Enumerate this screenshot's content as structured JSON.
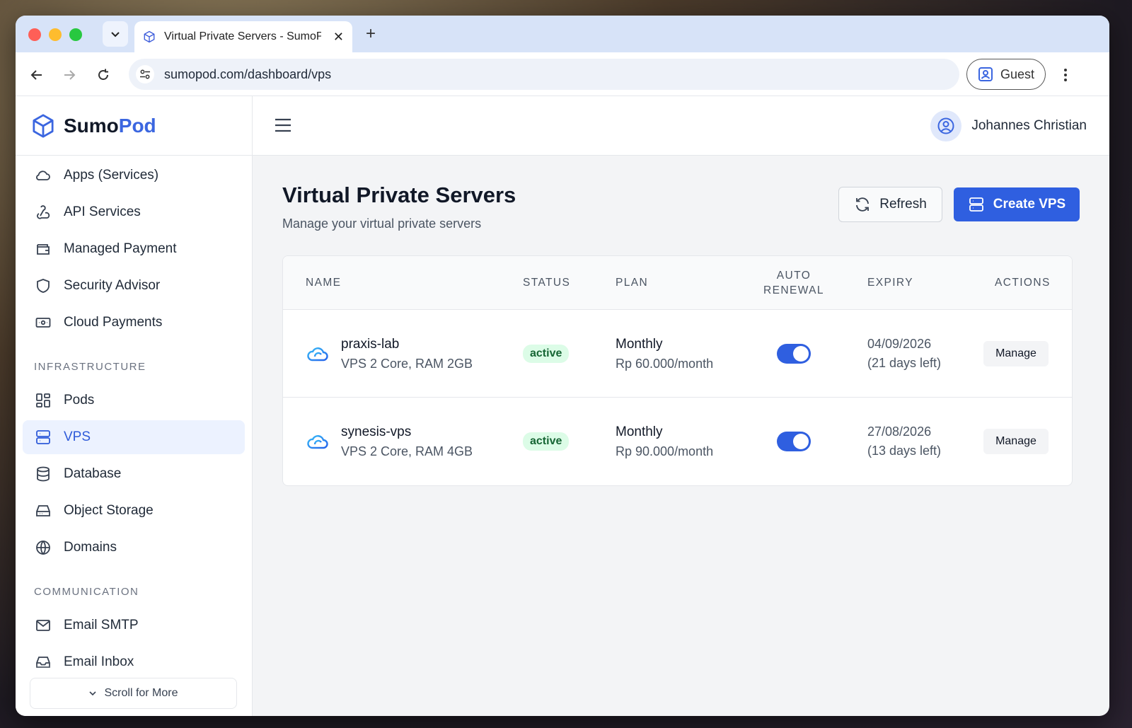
{
  "browser": {
    "tab_title": "Virtual Private Servers - SumoPod",
    "url": "sumopod.com/dashboard/vps",
    "profile_label": "Guest"
  },
  "brand": {
    "name_a": "Sumo",
    "name_b": "Pod"
  },
  "sidebar": {
    "items_top": [
      {
        "label": "Apps (Services)",
        "icon": "cloud-icon"
      },
      {
        "label": "API Services",
        "icon": "webhook-icon"
      },
      {
        "label": "Managed Payment",
        "icon": "wallet-icon"
      },
      {
        "label": "Security Advisor",
        "icon": "shield-icon"
      },
      {
        "label": "Cloud Payments",
        "icon": "banknote-icon"
      }
    ],
    "section_infra": "INFRASTRUCTURE",
    "items_infra": [
      {
        "label": "Pods",
        "icon": "grid-icon"
      },
      {
        "label": "VPS",
        "icon": "server-icon",
        "active": true
      },
      {
        "label": "Database",
        "icon": "database-icon"
      },
      {
        "label": "Object Storage",
        "icon": "hard-drive-icon"
      },
      {
        "label": "Domains",
        "icon": "globe-icon"
      }
    ],
    "section_comm": "COMMUNICATION",
    "items_comm": [
      {
        "label": "Email SMTP",
        "icon": "mail-icon"
      },
      {
        "label": "Email Inbox",
        "icon": "inbox-icon"
      }
    ],
    "scroll_more": "Scroll for More"
  },
  "header": {
    "user_name": "Johannes Christian"
  },
  "page": {
    "title": "Virtual Private Servers",
    "subtitle": "Manage your virtual private servers",
    "refresh_label": "Refresh",
    "create_label": "Create VPS"
  },
  "table": {
    "columns": {
      "name": "NAME",
      "status": "STATUS",
      "plan": "PLAN",
      "auto_renewal_a": "AUTO",
      "auto_renewal_b": "RENEWAL",
      "expiry": "EXPIRY",
      "actions": "ACTIONS"
    },
    "rows": [
      {
        "name": "praxis-lab",
        "spec": "VPS 2 Core, RAM 2GB",
        "status": "active",
        "plan": "Monthly",
        "price": "Rp 60.000/month",
        "auto_renewal": true,
        "expiry_date": "04/09/2026",
        "expiry_left": "(21 days left)",
        "action": "Manage"
      },
      {
        "name": "synesis-vps",
        "spec": "VPS 2 Core, RAM 4GB",
        "status": "active",
        "plan": "Monthly",
        "price": "Rp 90.000/month",
        "auto_renewal": true,
        "expiry_date": "27/08/2026",
        "expiry_left": "(13 days left)",
        "action": "Manage"
      }
    ]
  },
  "colors": {
    "accent": "#2f5fe0",
    "active_bg": "#ecf2ff",
    "badge_bg": "#dcfce7",
    "badge_text": "#166534"
  }
}
